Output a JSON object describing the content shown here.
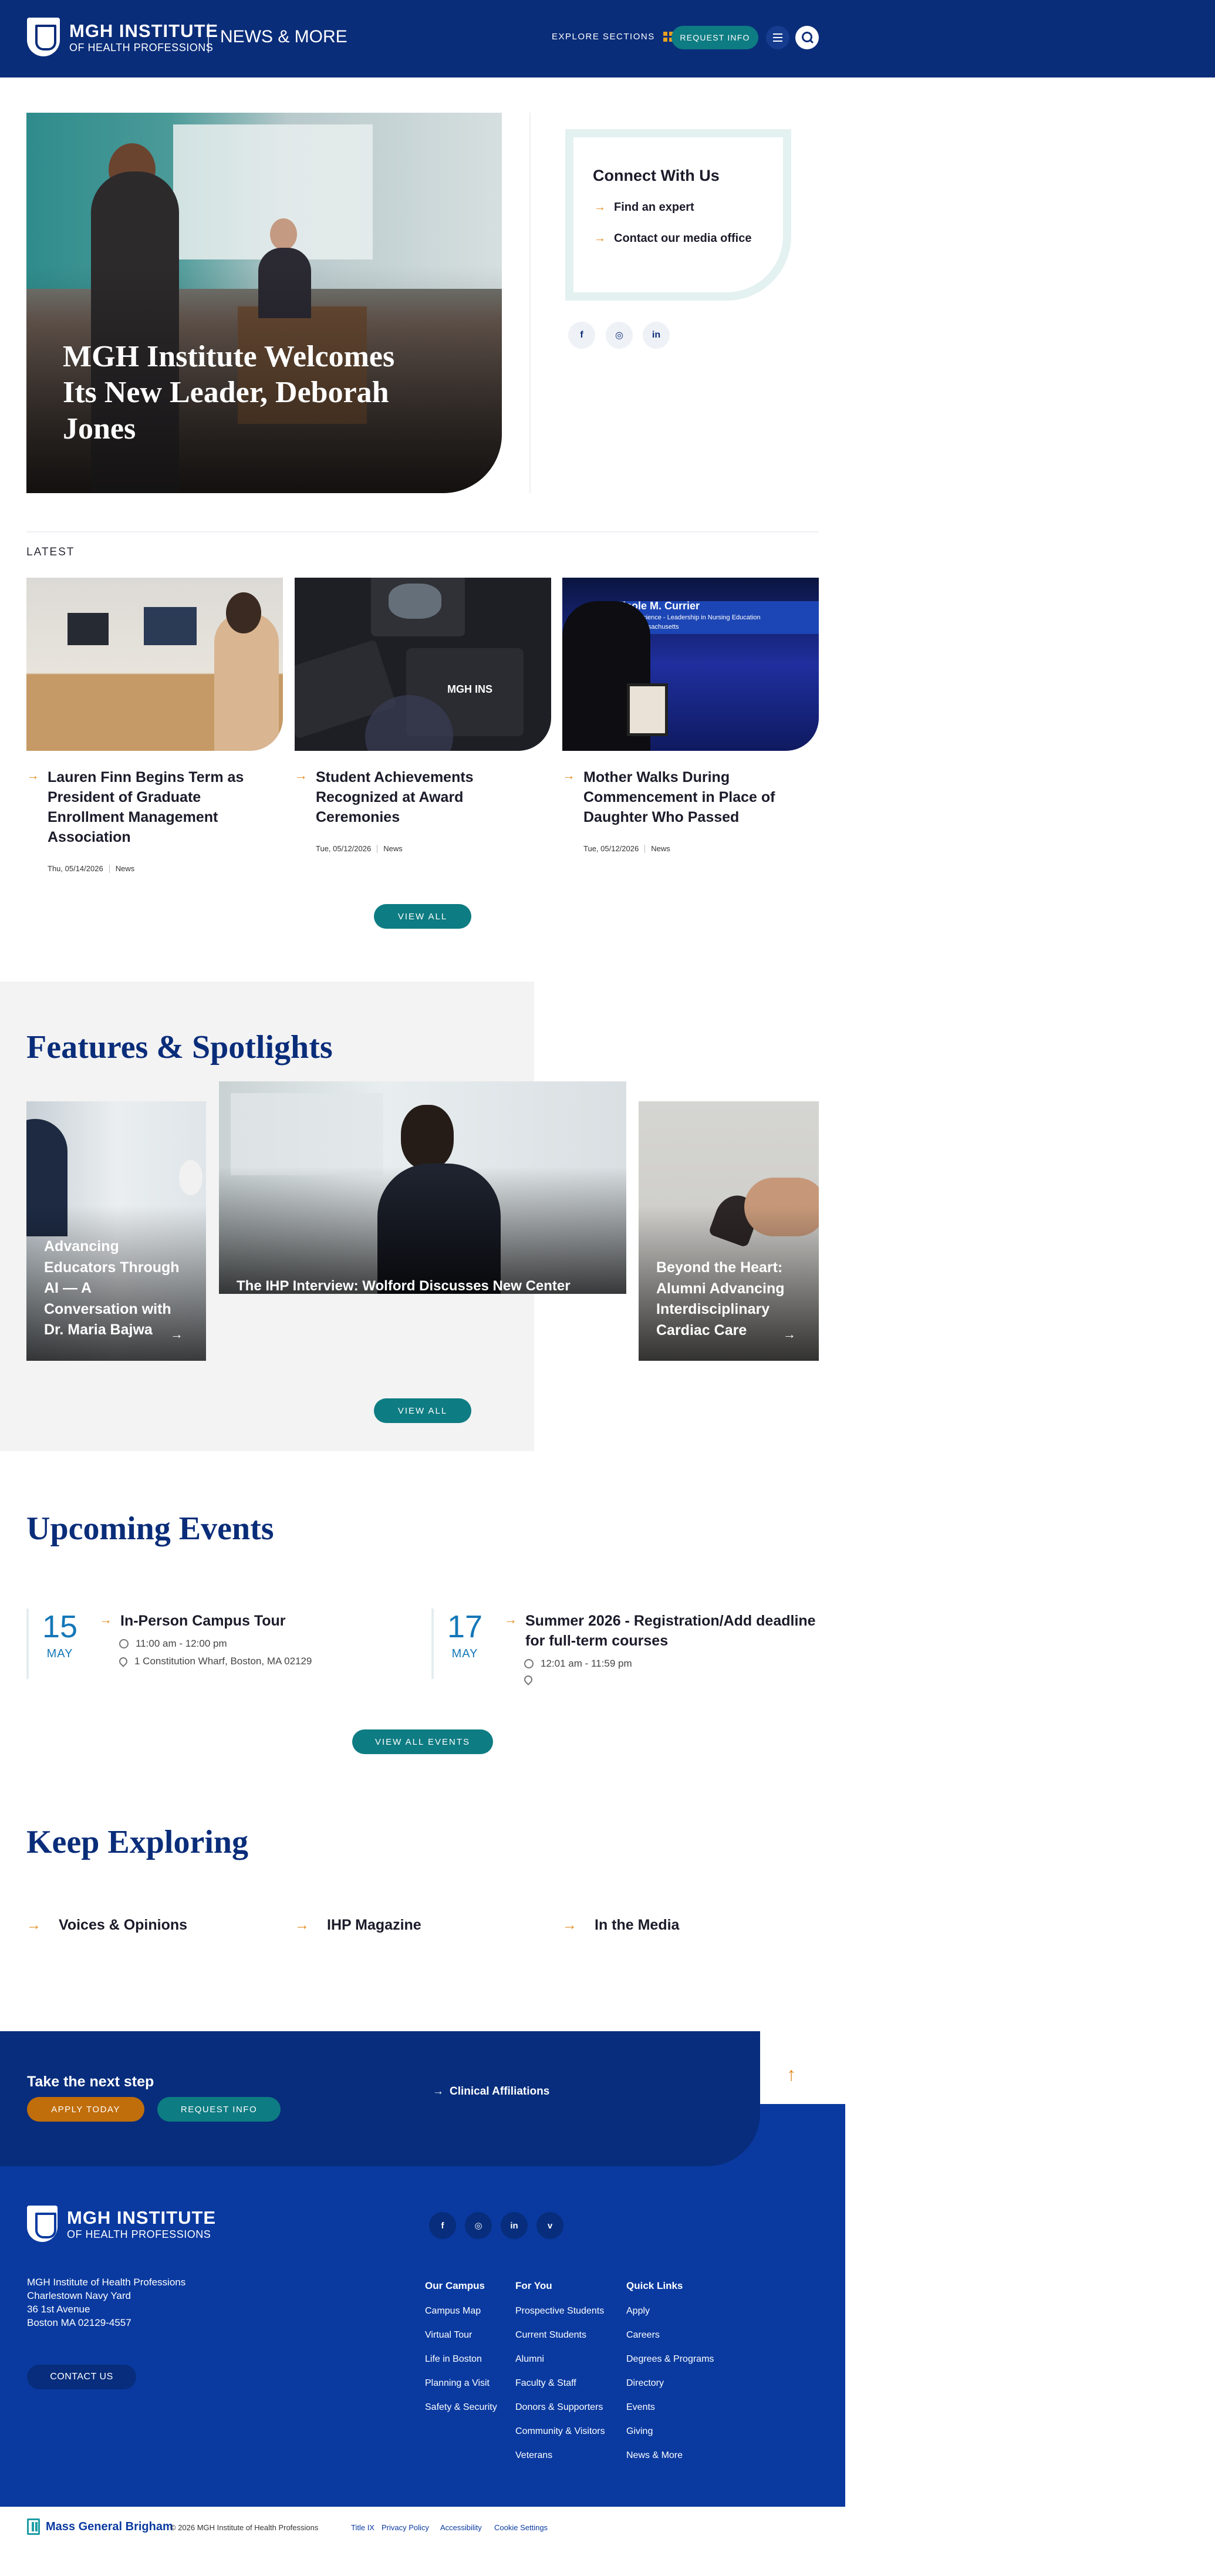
{
  "header": {
    "logo_line1": "MGH INSTITUTE",
    "logo_line2": "OF HEALTH PROFESSIONS",
    "section_name": "NEWS & MORE",
    "explore_label": "EXPLORE SECTIONS",
    "request_info_label": "REQUEST INFO",
    "menu_icon": "hamburger-icon",
    "search_icon": "search-icon"
  },
  "hero": {
    "title": "MGH Institute Welcomes Its New Leader, Deborah Jones"
  },
  "connect": {
    "title": "Connect With Us",
    "links": [
      "Find an expert",
      "Contact our media office"
    ],
    "social": [
      "f",
      "◎",
      "in"
    ]
  },
  "latest": {
    "label": "LATEST",
    "cards": [
      {
        "title": "Lauren Finn Begins Term as President of Graduate Enrollment Management Association",
        "date": "Thu, 05/14/2026",
        "tag": "News"
      },
      {
        "title": "Student Achievements Recognized at Award Ceremonies",
        "date": "Tue, 05/12/2026",
        "tag": "News"
      },
      {
        "title": "Mother Walks During Commencement in Place of Daughter Who Passed",
        "date": "Tue, 05/12/2026",
        "tag": "News"
      }
    ],
    "view_all": "VIEW ALL",
    "image3_banner_name": "Nicole M. Currier",
    "image3_banner_line2": "aster of Science - Leadership in Nursing Education",
    "image3_banner_line3": "abody, Massachusetts",
    "image2_box_text": "MGH INS"
  },
  "features": {
    "title": "Features & Spotlights",
    "cards": [
      {
        "title": "Advancing Educators Through AI — A Conversation with Dr. Maria Bajwa"
      },
      {
        "title": "The IHP Interview: Wolford Discusses New Center for Scholarship of Teaching and Learning"
      },
      {
        "title": "Beyond the Heart: Alumni Advancing Interdisciplinary Cardiac Care"
      }
    ],
    "view_all": "VIEW ALL"
  },
  "events": {
    "title": "Upcoming Events",
    "items": [
      {
        "day": "15",
        "month": "MAY",
        "title": "In-Person Campus Tour",
        "time": "11:00 am - 12:00 pm",
        "location": "1 Constitution Wharf, Boston, MA 02129"
      },
      {
        "day": "17",
        "month": "MAY",
        "title": "Summer 2026 - Registration/Add deadline for full-term courses",
        "time": "12:01 am - 11:59 pm",
        "location": ""
      }
    ],
    "view_all": "VIEW ALL EVENTS"
  },
  "keep_exploring": {
    "title": "Keep Exploring",
    "links": [
      "Voices & Opinions",
      "IHP Magazine",
      "In the Media"
    ]
  },
  "cta": {
    "title": "Take the next step",
    "apply": "APPLY TODAY",
    "request_info": "REQUEST INFO",
    "clinical": "Clinical Affiliations"
  },
  "footer": {
    "logo_line1": "MGH INSTITUTE",
    "logo_line2": "OF HEALTH PROFESSIONS",
    "address": [
      "MGH Institute of Health Professions",
      "Charlestown Navy Yard",
      "36 1st Avenue",
      "Boston MA 02129-4557"
    ],
    "contact_us": "CONTACT US",
    "social": [
      "f",
      "◎",
      "in",
      "v"
    ],
    "columns": [
      {
        "heading": "Our Campus",
        "items": [
          "Campus Map",
          "Virtual Tour",
          "Life in Boston",
          "Planning a Visit",
          "Safety & Security"
        ]
      },
      {
        "heading": "For You",
        "items": [
          "Prospective Students",
          "Current Students",
          "Alumni",
          "Faculty & Staff",
          "Donors & Supporters",
          "Community & Visitors",
          "Veterans"
        ]
      },
      {
        "heading": "Quick Links",
        "items": [
          "Apply",
          "Careers",
          "Degrees & Programs",
          "Directory",
          "Events",
          "Giving",
          "News & More"
        ]
      }
    ]
  },
  "bottom": {
    "brand": "Mass General Brigham",
    "copyright": "© 2026 MGH Institute of Health Professions",
    "links": [
      "Title IX",
      "Privacy Policy",
      "Accessibility",
      "Cookie Settings"
    ]
  },
  "colors": {
    "navy": "#0a2d7a",
    "footer_blue": "#0a3aa0",
    "teal": "#0e7c83",
    "accent_orange": "#e28a1a",
    "event_blue": "#1477b8"
  }
}
